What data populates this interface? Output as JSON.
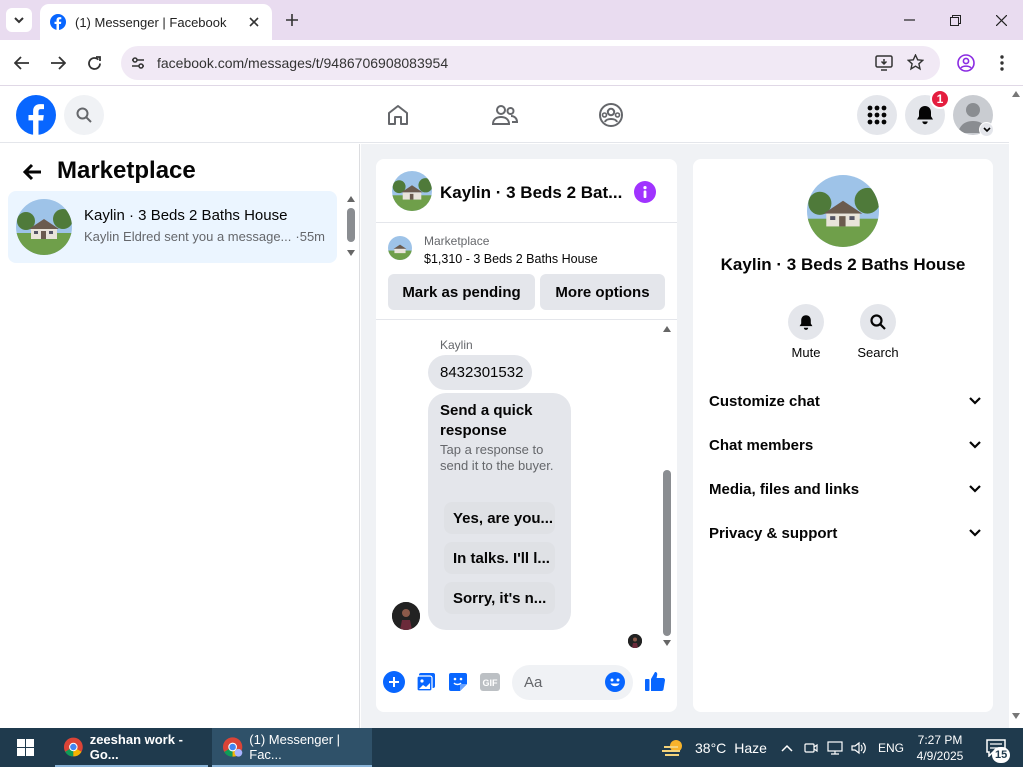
{
  "browser": {
    "tab_title": "(1) Messenger | Facebook",
    "url": "facebook.com/messages/t/9486706908083954"
  },
  "header": {
    "notification_count": "1"
  },
  "left": {
    "title": "Marketplace",
    "conversations": [
      {
        "name": "Kaylin · 3 Beds 2 Baths House",
        "preview": "Kaylin Eldred sent you a message...",
        "time": "·55m"
      }
    ]
  },
  "chat": {
    "title": "Kaylin · 3 Beds 2 Bat...",
    "listing_source": "Marketplace",
    "listing_price_title": "$1,310 - 3 Beds 2 Baths House",
    "mark_pending_label": "Mark as pending",
    "more_options_label": "More options",
    "sender_name": "Kaylin",
    "message_text": "8432301532",
    "quick_response_title": "Send a quick response",
    "quick_response_hint": "Tap a response to send it to the buyer.",
    "quick_replies": [
      "Yes, are you...",
      "In talks. I'll l...",
      "Sorry, it's n..."
    ],
    "composer_placeholder": "Aa"
  },
  "info": {
    "title": "Kaylin · 3 Beds 2 Baths House",
    "actions": [
      {
        "label": "Mute",
        "icon": "bell-icon"
      },
      {
        "label": "Search",
        "icon": "search-icon"
      }
    ],
    "sections": [
      "Customize chat",
      "Chat members",
      "Media, files and links",
      "Privacy & support"
    ]
  },
  "taskbar": {
    "item1": "zeeshan work - Go...",
    "item2": "(1) Messenger | Fac...",
    "weather_temp": "38°C",
    "weather_desc": "Haze",
    "language": "ENG",
    "time": "7:27 PM",
    "date": "4/9/2025",
    "notif_count": "15"
  },
  "colors": {
    "fb_blue": "#0866ff",
    "accent_purple": "#a033ff",
    "badge_red": "#e41e3f"
  }
}
